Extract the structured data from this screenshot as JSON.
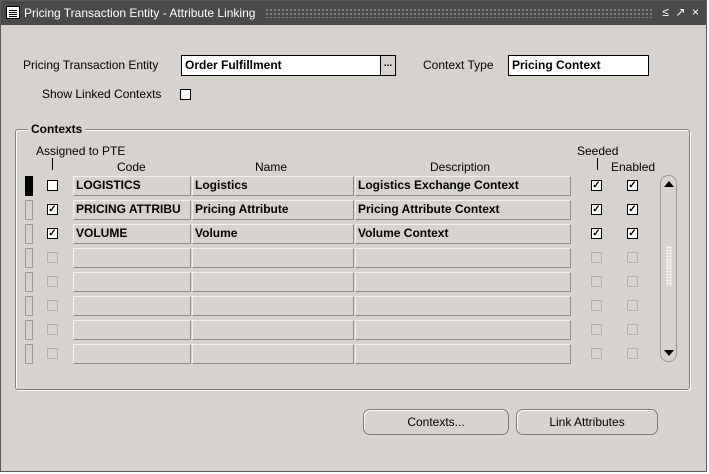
{
  "window": {
    "title": "Pricing Transaction Entity - Attribute Linking",
    "controls": [
      "≤",
      "↗",
      "×"
    ]
  },
  "header": {
    "pte_label": "Pricing Transaction Entity",
    "pte_value": "Order Fulfillment",
    "lov_glyph": "...",
    "context_type_label": "Context Type",
    "context_type_value": "Pricing Context",
    "show_linked_label": "Show Linked Contexts",
    "show_linked_checked": false
  },
  "contexts": {
    "title": "Contexts",
    "columns": {
      "assigned": "Assigned to PTE",
      "code": "Code",
      "name": "Name",
      "description": "Description",
      "seeded": "Seeded",
      "enabled": "Enabled"
    },
    "rows": [
      {
        "assigned": false,
        "code": "LOGISTICS",
        "name": "Logistics",
        "description": "Logistics Exchange Context",
        "seeded": true,
        "enabled": true
      },
      {
        "assigned": true,
        "code": "PRICING ATTRIBU",
        "name": "Pricing Attribute",
        "description": "Pricing Attribute Context",
        "seeded": true,
        "enabled": true
      },
      {
        "assigned": true,
        "code": "VOLUME",
        "name": "Volume",
        "description": "Volume Context",
        "seeded": true,
        "enabled": true
      },
      {
        "assigned": false,
        "code": "",
        "name": "",
        "description": "",
        "seeded": false,
        "enabled": false
      },
      {
        "assigned": false,
        "code": "",
        "name": "",
        "description": "",
        "seeded": false,
        "enabled": false
      },
      {
        "assigned": false,
        "code": "",
        "name": "",
        "description": "",
        "seeded": false,
        "enabled": false
      },
      {
        "assigned": false,
        "code": "",
        "name": "",
        "description": "",
        "seeded": false,
        "enabled": false
      },
      {
        "assigned": false,
        "code": "",
        "name": "",
        "description": "",
        "seeded": false,
        "enabled": false
      }
    ]
  },
  "buttons": {
    "contexts": "Contexts...",
    "link_attributes": "Link Attributes"
  }
}
